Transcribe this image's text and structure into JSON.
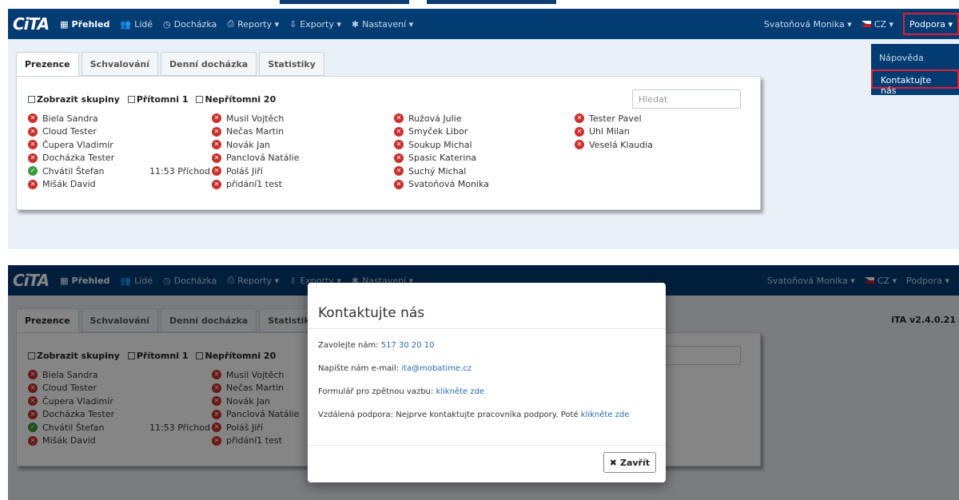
{
  "nav": {
    "logo": "CiTA",
    "items": [
      {
        "icon": "grid-icon",
        "glyph": "▦",
        "label": "Přehled",
        "active": true
      },
      {
        "icon": "people-icon",
        "glyph": "👥",
        "label": "Lidé"
      },
      {
        "icon": "clock-icon",
        "glyph": "◷",
        "label": "Docházka"
      },
      {
        "icon": "printer-icon",
        "glyph": "⎙",
        "label": "Reporty ▾"
      },
      {
        "icon": "export-icon",
        "glyph": "⇩",
        "label": "Exporty ▾"
      },
      {
        "icon": "gear-icon",
        "glyph": "✱",
        "label": "Nastavení ▾"
      }
    ],
    "user": "Svatoňová Monika ▾",
    "lang": "CZ ▾",
    "support": "Podpora ▾"
  },
  "dropdown": {
    "items": [
      "Nápověda",
      "Kontaktujte nás"
    ]
  },
  "tabs": [
    "Prezence",
    "Schvalování",
    "Denní docházka",
    "Statistiky"
  ],
  "filters": {
    "groups": "Zobrazit skupiny",
    "present": "Přítomni 1",
    "absent": "Nepřítomni 20",
    "search_placeholder": "Hledat"
  },
  "columns": [
    [
      {
        "name": "Biela Sandra",
        "status": "absent"
      },
      {
        "name": "Cloud Tester",
        "status": "absent"
      },
      {
        "name": "Čupera Vladimír",
        "status": "absent"
      },
      {
        "name": "Docházka Tester",
        "status": "absent"
      },
      {
        "name": "Chvátil Štefan",
        "status": "present",
        "time": "11:53 Příchod"
      },
      {
        "name": "Mišák David",
        "status": "absent"
      }
    ],
    [
      {
        "name": "Musil Vojtěch",
        "status": "absent"
      },
      {
        "name": "Nečas Martin",
        "status": "absent"
      },
      {
        "name": "Novák Jan",
        "status": "absent"
      },
      {
        "name": "Panclová Natálie",
        "status": "absent"
      },
      {
        "name": "Poláš Jiří",
        "status": "absent"
      },
      {
        "name": "přidání1 test",
        "status": "absent"
      }
    ],
    [
      {
        "name": "Ružová Julie",
        "status": "absent"
      },
      {
        "name": "Smyček Libor",
        "status": "absent"
      },
      {
        "name": "Soukup Michal",
        "status": "absent"
      },
      {
        "name": "Spasic Katerina",
        "status": "absent"
      },
      {
        "name": "Suchý Michal",
        "status": "absent"
      },
      {
        "name": "Svatoňová Monika",
        "status": "absent"
      }
    ],
    [
      {
        "name": "Tester Pavel",
        "status": "absent"
      },
      {
        "name": "Uhl Milan",
        "status": "absent"
      },
      {
        "name": "Veselá Klaudia",
        "status": "absent"
      }
    ]
  ],
  "version": "iTA v2.4.0.21",
  "modal": {
    "title": "Kontaktujte nás",
    "call_label": "Zavolejte nám: ",
    "call_value": "517 30 20 10",
    "email_label": "Napište nám e-mail: ",
    "email_value": "ita@mobatime.cz",
    "form_label": "Formulář pro zpětnou vazbu: ",
    "form_link": "klikněte zde",
    "remote_label": "Vzdálená podpora: Nejprve kontaktujte pracovníka podpory. Poté ",
    "remote_link": "klikněte zde",
    "close": "Zavřít"
  }
}
